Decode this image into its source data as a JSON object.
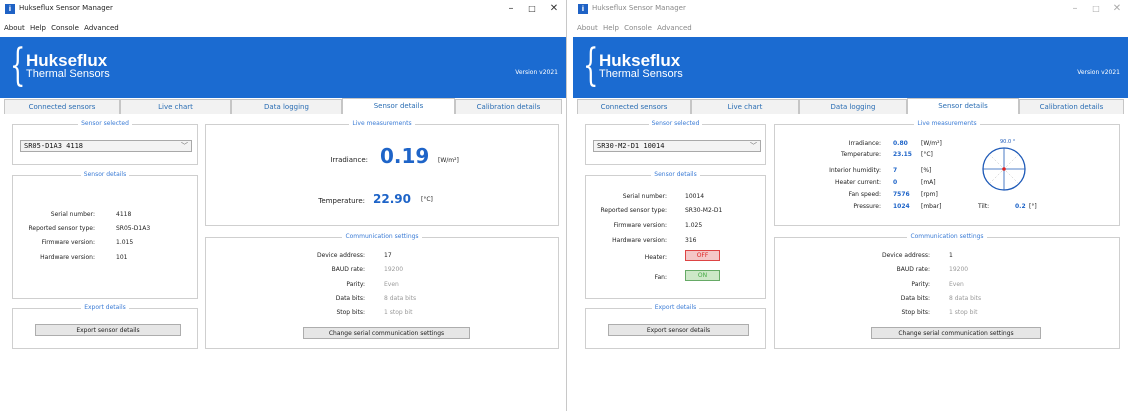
{
  "app_title": "Hukseflux Sensor Manager",
  "menu": [
    "About",
    "Help",
    "Console",
    "Advanced"
  ],
  "brand": {
    "name": "Hukseflux",
    "subtitle": "Thermal Sensors",
    "color": "#1b6bd1"
  },
  "version": "Version v2021",
  "window_controls": {
    "minimize": "–",
    "maximize": "□",
    "close": "✕"
  },
  "tabs": [
    "Connected sensors",
    "Live chart",
    "Data logging",
    "Sensor details",
    "Calibration details"
  ],
  "selected_tab": "Sensor details",
  "left": {
    "sensor_selected_title": "Sensor selected",
    "sensor_selected": "SR05-D1A3   4118",
    "details_title": "Sensor details",
    "details": [
      {
        "label": "Serial number:",
        "value": "4118"
      },
      {
        "label": "Reported sensor type:",
        "value": "SR05-D1A3"
      },
      {
        "label": "Firmware version:",
        "value": "1.015"
      },
      {
        "label": "Hardware version:",
        "value": "101"
      }
    ],
    "export_title": "Export details",
    "export_button": "Export sensor details",
    "live_title": "Live measurements",
    "irradiance_label": "Irradiance:",
    "irradiance_value": "0.19",
    "irradiance_unit": "[W/m²]",
    "temperature_label": "Temperature:",
    "temperature_value": "22.90",
    "temperature_unit": "[°C]",
    "comm_title": "Communication settings",
    "comm": [
      {
        "label": "Device address:",
        "value": "17"
      },
      {
        "label": "BAUD rate:",
        "value": "19200"
      },
      {
        "label": "Parity:",
        "value": "Even"
      },
      {
        "label": "Data bits:",
        "value": "8 data bits"
      },
      {
        "label": "Stop bits:",
        "value": "1 stop bit"
      }
    ],
    "comm_button": "Change serial communication settings"
  },
  "right": {
    "sensor_selected_title": "Sensor selected",
    "sensor_selected": "SR30-M2-D1   10014",
    "details_title": "Sensor details",
    "details": [
      {
        "label": "Serial number:",
        "value": "10014"
      },
      {
        "label": "Reported sensor type:",
        "value": "SR30-M2-D1"
      },
      {
        "label": "Firmware version:",
        "value": "1.025"
      },
      {
        "label": "Hardware version:",
        "value": "316"
      }
    ],
    "heater_label": "Heater:",
    "heater_state": "OFF",
    "fan_label": "Fan:",
    "fan_state": "ON",
    "export_title": "Export details",
    "export_button": "Export sensor details",
    "live_title": "Live measurements",
    "measurements": [
      {
        "label": "Irradiance:",
        "value": "0.80",
        "unit": "[W/m²]"
      },
      {
        "label": "Temperature:",
        "value": "23.15",
        "unit": "[°C]"
      },
      {
        "label": "Interior humidity:",
        "value": "7",
        "unit": "[%]"
      },
      {
        "label": "Heater current:",
        "value": "0",
        "unit": "[mA]"
      },
      {
        "label": "Fan speed:",
        "value": "7576",
        "unit": "[rpm]"
      },
      {
        "label": "Pressure:",
        "value": "1024",
        "unit": "[mbar]"
      }
    ],
    "tilt_dial_label": "90.0 °",
    "tilt_label": "Tilt:",
    "tilt_value": "0.2",
    "tilt_unit": "[°]",
    "comm_title": "Communication settings",
    "comm": [
      {
        "label": "Device address:",
        "value": "1"
      },
      {
        "label": "BAUD rate:",
        "value": "19200"
      },
      {
        "label": "Parity:",
        "value": "Even"
      },
      {
        "label": "Data bits:",
        "value": "8 data bits"
      },
      {
        "label": "Stop bits:",
        "value": "1 stop bit"
      }
    ],
    "comm_button": "Change serial communication settings"
  }
}
